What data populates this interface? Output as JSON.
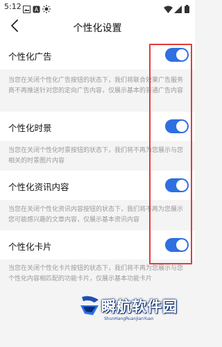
{
  "status_bar": {
    "time": "5:12",
    "icons": [
      "image-icon",
      "notification-a-icon",
      "brightness-icon",
      "wifi-icon",
      "signal-icon",
      "battery-icon"
    ]
  },
  "header": {
    "back_icon": "chevron-left-icon",
    "title": "个性化设置"
  },
  "settings": [
    {
      "label": "个性化广告",
      "enabled": true,
      "description": "当您在关闭个性化广告按钮的状态下，我们将联合效果广告服务商不再推送针对您的定向广告内容，仅展示基本的普通广告内容"
    },
    {
      "label": "个性化时景",
      "enabled": true,
      "description": "当您在关闭个性化时景按钮的状态下，我们将不再为您展示与您相关的时景图片内容"
    },
    {
      "label": "个性化资讯内容",
      "enabled": true,
      "description": "当您在关闭个性化资讯内容按钮的状态下，我们将不再为您展示您可能感兴趣的文章内容，仅展示基本资讯内容"
    },
    {
      "label": "个性化卡片",
      "enabled": true,
      "description": "当您在关闭个性化卡片按钮的状态下，我们将不再为您展示与您个性化内容相匹配的功能卡片，仅展示基本功能卡片"
    }
  ],
  "colors": {
    "toggle_on": "#2f6fe0",
    "highlight": "#e23b3b",
    "description_text": "#9a9a9a",
    "background": "#f4f4f4"
  },
  "watermark": {
    "title": "瞬航软件园",
    "subtitle": "ShunHangRuanJianYuan"
  }
}
